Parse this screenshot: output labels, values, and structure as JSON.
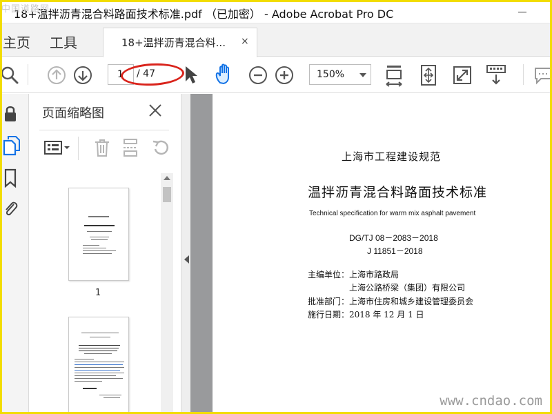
{
  "window": {
    "title": "18+温拌沥青混合料路面技术标准.pdf （已加密） - Adobe Acrobat Pro DC",
    "watermark_top": "中国道路网",
    "watermark_bottom": "www.cndao.com"
  },
  "tabs": {
    "home": "主页",
    "tools": "工具",
    "document": "18+温拌沥青混合料...",
    "close": "×"
  },
  "toolbar": {
    "current_page": "1",
    "total_pages": "/ 47",
    "zoom": "150%",
    "highlight_color": "#d9231b"
  },
  "thumbnails_panel": {
    "title": "页面缩略图",
    "pages": [
      {
        "number": "1"
      }
    ]
  },
  "document": {
    "dept": "上海市工程建设规范",
    "title": "温拌沥青混合料路面技术标准",
    "title_en": "Technical specification for warm mix asphalt pavement",
    "code": "DG/TJ 08－2083－2018",
    "record_code": "J 11851－2018",
    "editor_unit": "主编单位：上海市路政局",
    "co_unit": "上海公路桥梁（集团）有限公司",
    "approver": "批准部门：上海市住房和城乡建设管理委员会",
    "effective": "施行日期：2018 年 12 月 1 日"
  },
  "colors": {
    "accent_blue": "#1473e6",
    "frame_yellow": "#f2dd00"
  }
}
